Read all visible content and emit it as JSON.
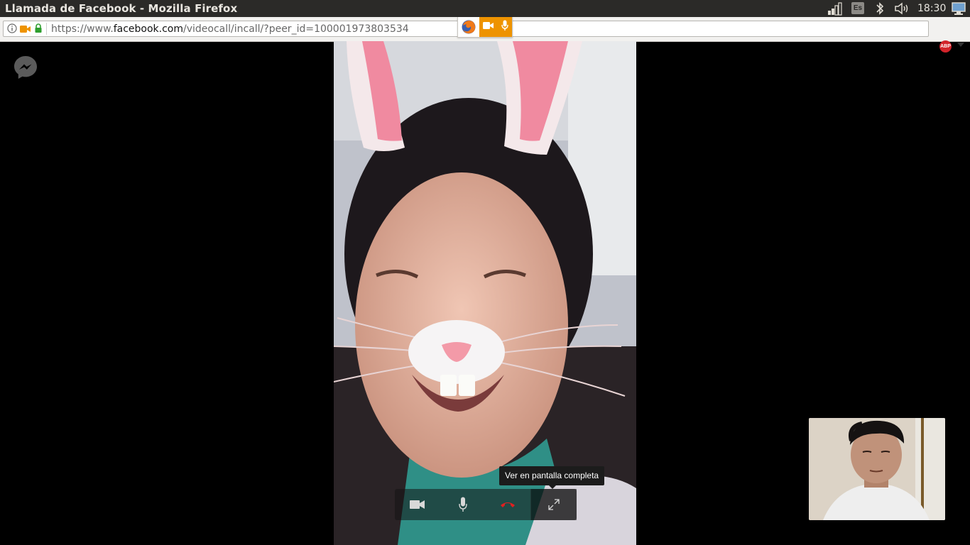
{
  "window": {
    "title": "Llamada de Facebook - Mozilla Firefox"
  },
  "tray": {
    "keyboard_layout": "Es",
    "clock": "18:30",
    "icons": [
      "network-signal-icon",
      "keyboard-layout-icon",
      "bluetooth-icon",
      "volume-icon",
      "computer-icon"
    ]
  },
  "urlbar": {
    "url_prefix": "https://www.",
    "url_domain": "facebook.com",
    "url_path": "/videocall/incall/?peer_id=100001973803534",
    "indicators": [
      "info-icon",
      "camera-icon",
      "lock-icon"
    ]
  },
  "sharing_indicator": {
    "app_icon": "firefox-icon",
    "devices": [
      "camera-icon",
      "microphone-icon"
    ],
    "accent_color": "#ee9300"
  },
  "addons": {
    "abp_label": "ABP"
  },
  "call": {
    "logo_icon": "messenger-icon",
    "tooltip": "Ver en pantalla completa",
    "controls": [
      {
        "name": "camera-toggle",
        "icon": "video-camera-icon"
      },
      {
        "name": "mic-toggle",
        "icon": "microphone-icon"
      },
      {
        "name": "end-call",
        "icon": "hang-up-icon",
        "color": "#e02020"
      },
      {
        "name": "fullscreen",
        "icon": "expand-icon"
      }
    ]
  },
  "colors": {
    "page_background": "#000000",
    "system_bar": "#2b2a28",
    "navbar": "#f2f1ef"
  }
}
